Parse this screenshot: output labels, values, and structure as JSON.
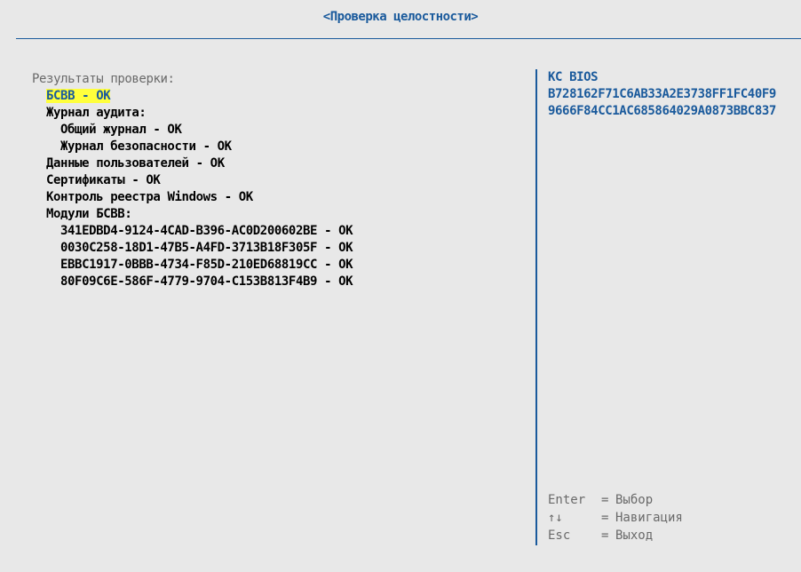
{
  "window": {
    "title": "<Проверка целостности>"
  },
  "results": {
    "header": "Результаты проверки:",
    "selected_item": "БСВВ - ОК",
    "audit_header": "Журнал аудита:",
    "audit_items": [
      "Общий журнал - ОК",
      "Журнал безопасности - ОК"
    ],
    "user_data": "Данные пользователей - ОК",
    "certificates": "Сертификаты - ОК",
    "registry": "Контроль реестра Windows - ОК",
    "modules_header": "Модули БСВВ:",
    "modules": [
      "341EDBD4-9124-4CAD-B396-AC0D200602BE - ОК",
      "0030C258-18D1-47B5-A4FD-3713B18F305F - ОК",
      "EBBC1917-0BBB-4734-F85D-210ED68819CC - ОК",
      "80F09C6E-586F-4779-9704-C153B813F4B9 - ОК"
    ]
  },
  "details": {
    "title": "КС BIOS",
    "hash_line_1": "B728162F71C6AB33A2E3738FF1FC40F9",
    "hash_line_2": "9666F84CC1AC685864029A0873BBC837"
  },
  "help": [
    {
      "key": "Enter",
      "eq": "=",
      "action": "Выбор"
    },
    {
      "key": "↑↓",
      "eq": "=",
      "action": "Навигация"
    },
    {
      "key": "Esc",
      "eq": "=",
      "action": "Выход"
    }
  ],
  "colors": {
    "background": "#e8e8e8",
    "accent": "#1a5a9c",
    "highlight": "#ffff3c",
    "muted": "#6a6a6a"
  }
}
